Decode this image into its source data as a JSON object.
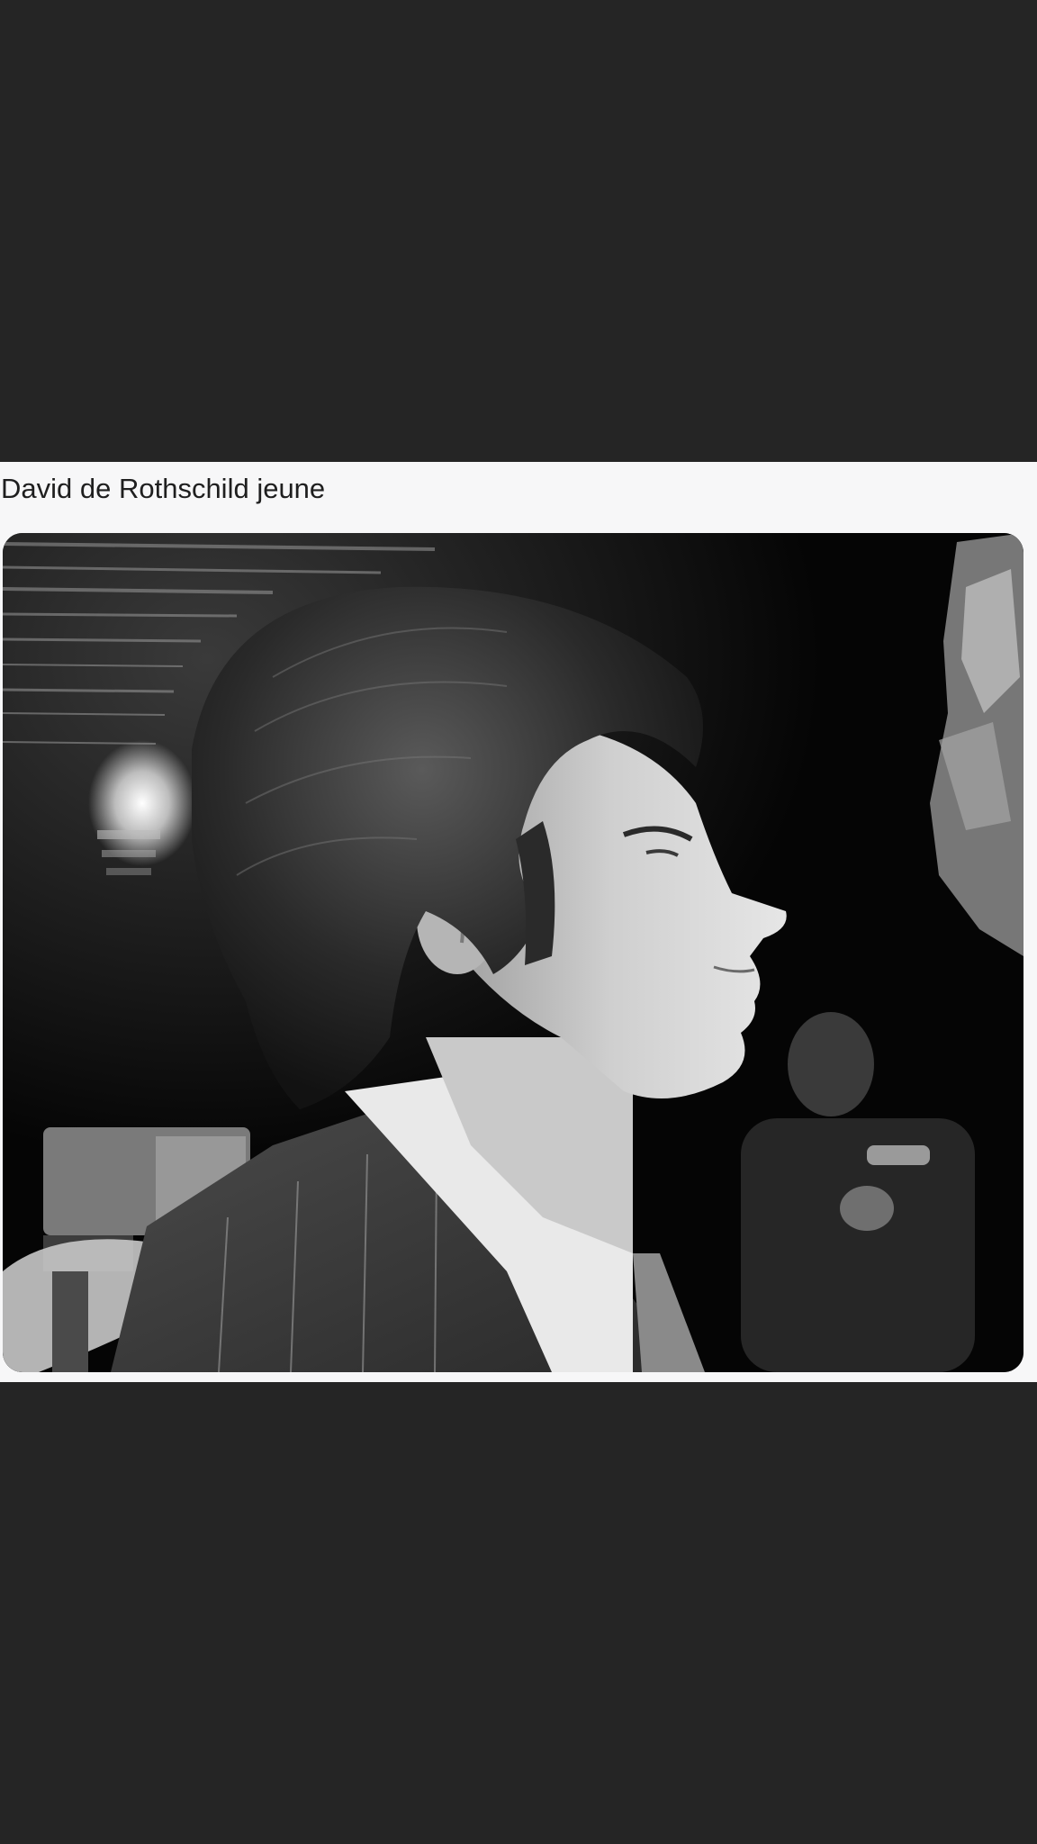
{
  "page": {
    "background": "#252525"
  },
  "result_card": {
    "background": "#f7f7f8",
    "caption": "David de Rothschild jeune",
    "image": {
      "semantic": "black-and-white photograph, young man in profile",
      "style": "grayscale"
    }
  }
}
